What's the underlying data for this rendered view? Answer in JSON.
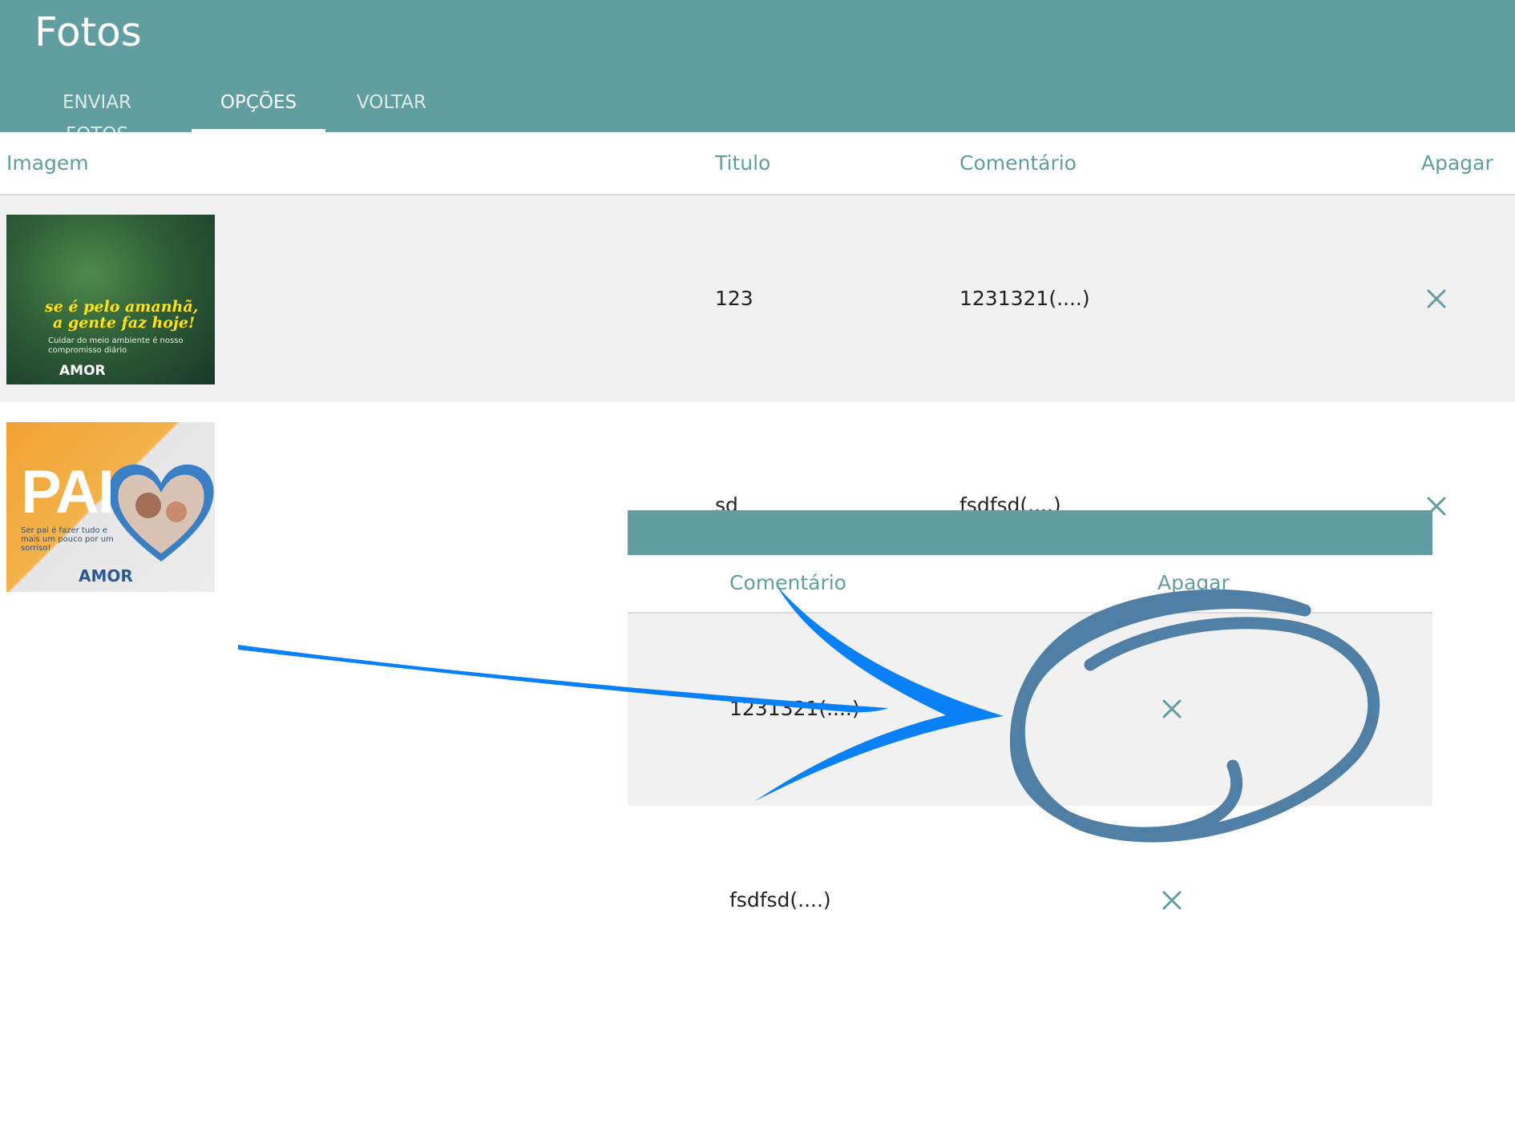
{
  "app": {
    "title": "Fotos"
  },
  "tabs": [
    {
      "label": "ENVIAR FOTOS",
      "active": false
    },
    {
      "label": "OPÇÕES",
      "active": true
    },
    {
      "label": "VOLTAR",
      "active": false
    }
  ],
  "table": {
    "headers": {
      "imagem": "Imagem",
      "titulo": "Titulo",
      "comentario": "Comentário",
      "apagar": "Apagar"
    },
    "rows": [
      {
        "titulo": "123",
        "comentario": "1231321(....)",
        "thumb": {
          "line1": "se é pelo amanhã,",
          "line2": "a gente faz hoje!",
          "sub": "Cuidar do meio ambiente é nosso compromisso diário",
          "brand": "AMOR"
        }
      },
      {
        "titulo": "sd",
        "comentario": "fsdfsd(....)",
        "thumb": {
          "headline": "PAI",
          "sub": "Ser pai é fazer tudo e mais um pouco por um sorriso!",
          "brand": "AMOR"
        }
      }
    ]
  },
  "zoom": {
    "headers": {
      "comentario": "Comentário",
      "apagar": "Apagar"
    },
    "rows": [
      {
        "comentario": "1231321(....)"
      },
      {
        "comentario": "fsdfsd(....)"
      }
    ]
  },
  "colors": {
    "primary": "#619e9f",
    "row_highlight": "#f1f1f1",
    "annotation_arrow": "#0a80f7",
    "annotation_circle": "#4f7fa5"
  },
  "icons": {
    "delete": "close-icon"
  }
}
